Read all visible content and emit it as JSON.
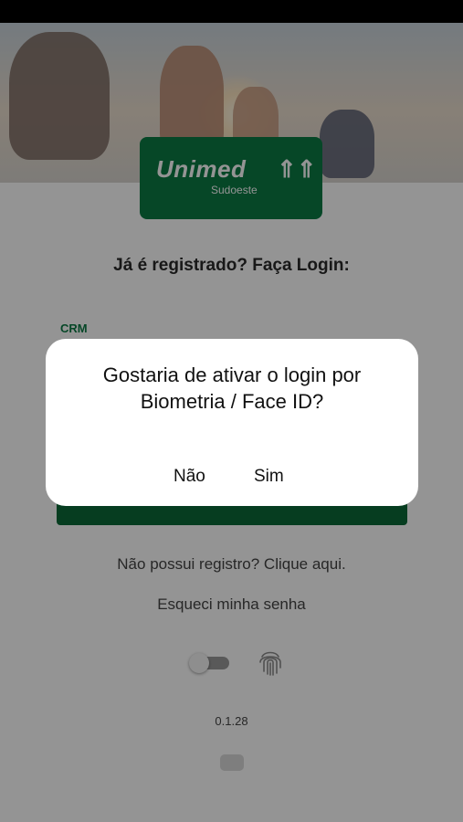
{
  "logo": {
    "word": "Unimed",
    "sub": "Sudoeste",
    "mark": "⇑⇑"
  },
  "login": {
    "heading": "Já é registrado? Faça Login:",
    "crm_label": "CRM"
  },
  "links": {
    "register": "Não possui registro? Clique aqui.",
    "forgot": "Esqueci minha senha"
  },
  "biometrics": {
    "toggle_on": false,
    "fingerprint_icon": "fingerprint-icon"
  },
  "version": "0.1.28",
  "dialog": {
    "message": "Gostaria de ativar o login por Biometria / Face ID?",
    "no_label": "Não",
    "yes_label": "Sim"
  },
  "colors": {
    "brand": "#0b7a44",
    "brand_dark": "#0b6a38"
  }
}
